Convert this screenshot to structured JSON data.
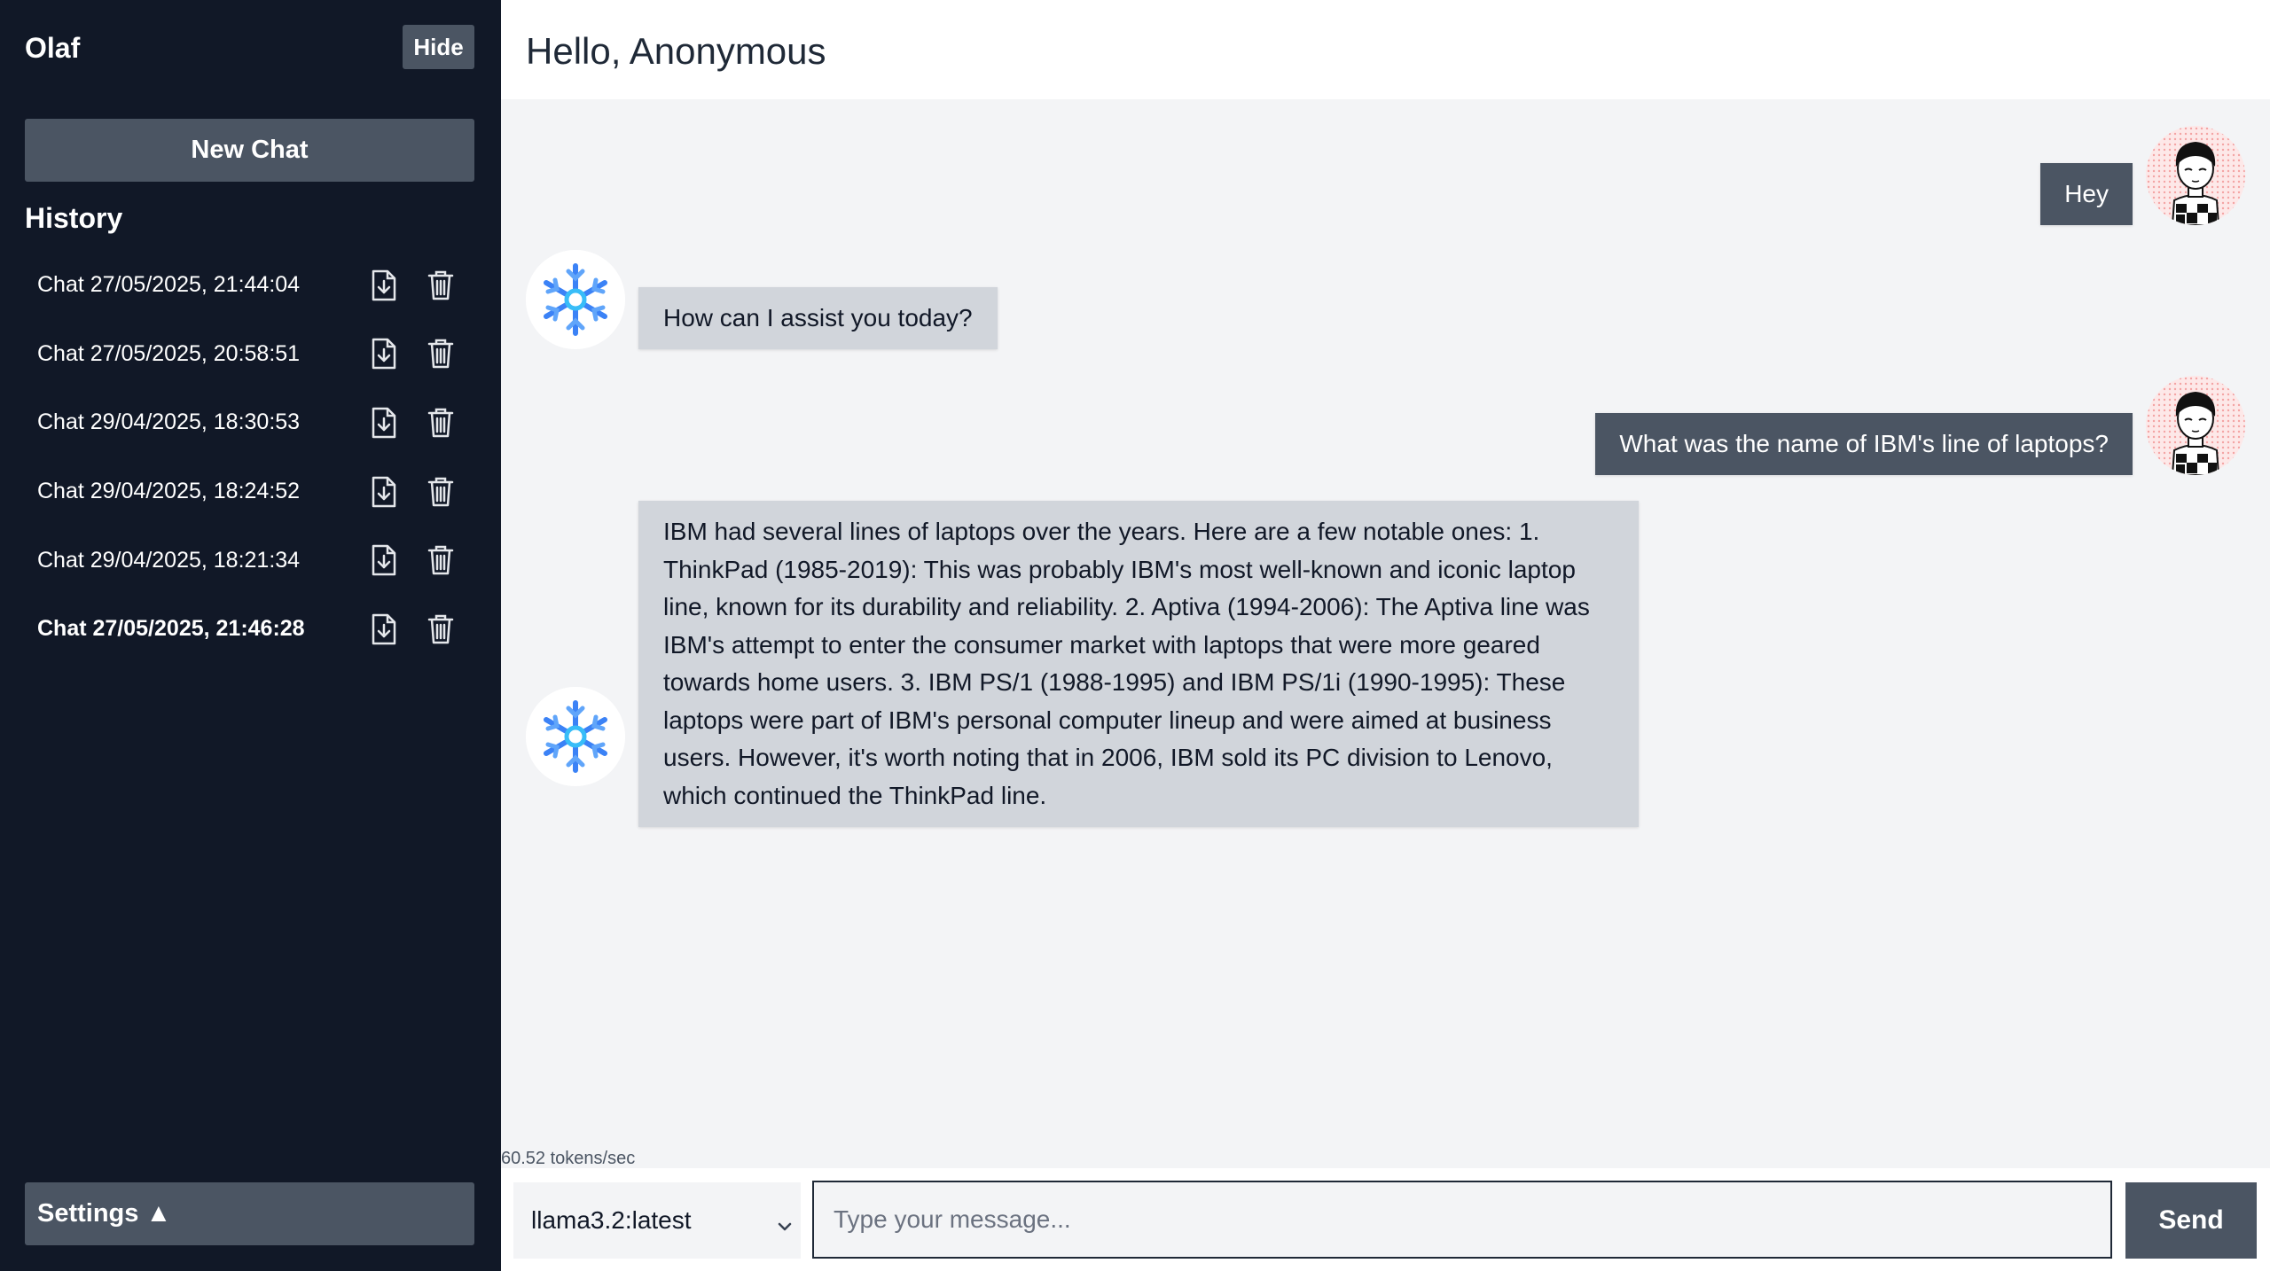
{
  "app": {
    "title": "Olaf",
    "hide_label": "Hide"
  },
  "sidebar": {
    "new_chat_label": "New Chat",
    "history_title": "History",
    "history": [
      {
        "label": "Chat 27/05/2025, 21:44:04",
        "active": false
      },
      {
        "label": "Chat 27/05/2025, 20:58:51",
        "active": false
      },
      {
        "label": "Chat 29/04/2025, 18:30:53",
        "active": false
      },
      {
        "label": "Chat 29/04/2025, 18:24:52",
        "active": false
      },
      {
        "label": "Chat 29/04/2025, 18:21:34",
        "active": false
      },
      {
        "label": "Chat 27/05/2025, 21:46:28",
        "active": true
      }
    ],
    "settings_label": "Settings ▲"
  },
  "header": {
    "greeting": "Hello, Anonymous"
  },
  "messages": [
    {
      "role": "user",
      "text": "Hey"
    },
    {
      "role": "assistant",
      "text": "How can I assist you today?"
    },
    {
      "role": "user",
      "text": "What was the name of IBM's line of laptops?"
    },
    {
      "role": "assistant",
      "text": "IBM had several lines of laptops over the years. Here are a few notable ones: 1. ThinkPad (1985-2019): This was probably IBM's most well-known and iconic laptop line, known for its durability and reliability. 2. Aptiva (1994-2006): The Aptiva line was IBM's attempt to enter the consumer market with laptops that were more geared towards home users. 3. IBM PS/1 (1988-1995) and IBM PS/1i (1990-1995): These laptops were part of IBM's personal computer lineup and were aimed at business users. However, it's worth noting that in 2006, IBM sold its PC division to Lenovo, which continued the ThinkPad line."
    }
  ],
  "stats": {
    "tokens_per_sec": "60.52 tokens/sec"
  },
  "composer": {
    "model": "llama3.2:latest",
    "placeholder": "Type your message...",
    "send_label": "Send"
  },
  "colors": {
    "sidebar_bg": "#111827",
    "button_bg": "#4b5563",
    "bot_bubble": "#d1d5db",
    "main_bg": "#f3f4f6",
    "snowflake": "#3b82f6"
  }
}
